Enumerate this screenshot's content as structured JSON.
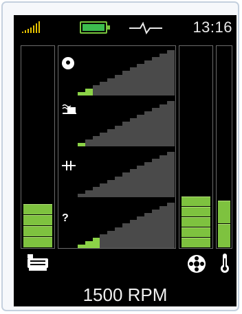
{
  "header": {
    "time": "13:16",
    "battery_color": "#3dbd4f",
    "signal_color": "#e8c400",
    "signal_icon": "signal-strength-icon",
    "battery_icon": "battery-icon",
    "pulse_icon": "pulse-wave-icon"
  },
  "left_gauge": {
    "icon": "pump-motor-icon",
    "level_fraction": 0.3,
    "segments_lit": 4
  },
  "right_gauge_1": {
    "icon": "fan-wheel-icon",
    "level_fraction": 0.37,
    "segments_lit": 5
  },
  "right_gauge_2": {
    "icon": "thermometer-icon",
    "level_fraction": 0.34,
    "segments_lit": 2
  },
  "meters": [
    {
      "icon": "gear-icon",
      "lit": 2,
      "total": 13
    },
    {
      "icon": "flow-tank-icon",
      "lit": 1,
      "total": 13
    },
    {
      "icon": "filter-bracket-icon",
      "lit": 0,
      "total": 13
    },
    {
      "icon": "unknown-icon",
      "label": "?",
      "lit": 3,
      "total": 13
    }
  ],
  "footer": {
    "speed_text": "1500 RPM"
  },
  "colors": {
    "accent": "#7ec23f",
    "inactive": "#4a4a4a"
  }
}
